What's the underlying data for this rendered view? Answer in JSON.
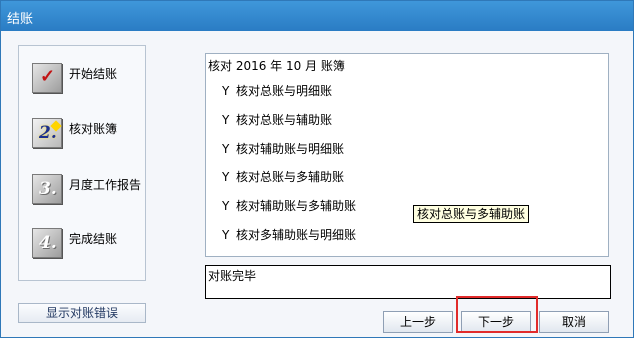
{
  "window": {
    "title": "结账"
  },
  "steps": [
    {
      "number": "✓",
      "label": "开始结账",
      "state": "done"
    },
    {
      "number": "2.",
      "label": "核对账簿",
      "state": "active"
    },
    {
      "number": "3.",
      "label": "月度工作报告",
      "state": "pending"
    },
    {
      "number": "4.",
      "label": "完成结账",
      "state": "pending"
    }
  ],
  "error_button": {
    "label": "显示对账错误"
  },
  "check": {
    "title": "核对 2016 年 10 月 账簿",
    "items": [
      {
        "mark": "Y",
        "label": "核对总账与明细账"
      },
      {
        "mark": "Y",
        "label": "核对总账与辅助账"
      },
      {
        "mark": "Y",
        "label": "核对辅助账与明细账"
      },
      {
        "mark": "Y",
        "label": "核对总账与多辅助账"
      },
      {
        "mark": "Y",
        "label": "核对辅助账与多辅助账"
      },
      {
        "mark": "Y",
        "label": "核对多辅助账与明细账"
      }
    ],
    "tooltip": "核对总账与多辅助账"
  },
  "result": {
    "text": "对账完毕"
  },
  "buttons": {
    "prev": "上一步",
    "next": "下一步",
    "cancel": "取消"
  },
  "colors": {
    "highlight": "#e12b2b",
    "title_bar": "#3f97da"
  }
}
